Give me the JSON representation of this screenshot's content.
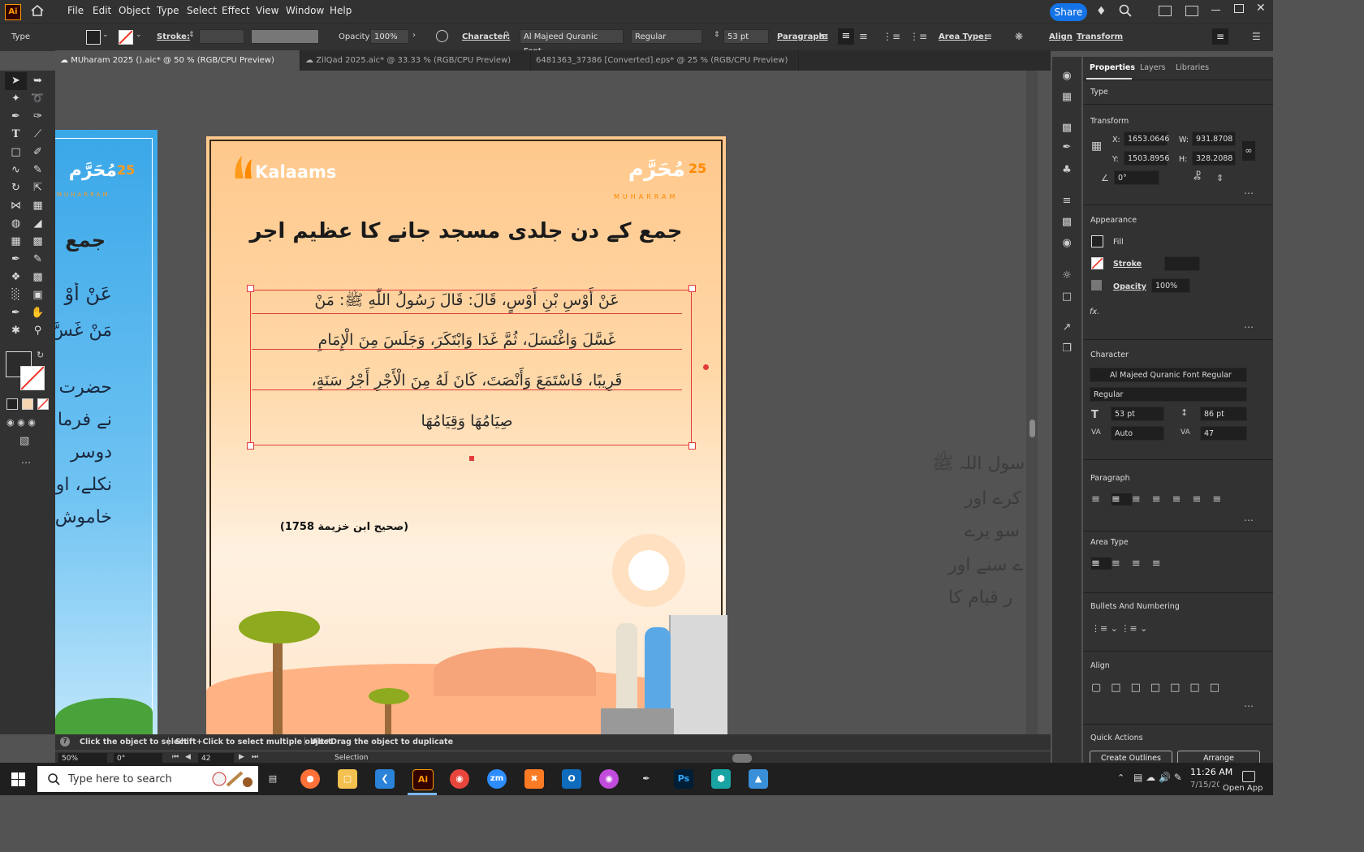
{
  "menu": {
    "logo": "Ai",
    "items": [
      "File",
      "Edit",
      "Object",
      "Type",
      "Select",
      "Effect",
      "View",
      "Window",
      "Help"
    ],
    "share": "Share"
  },
  "control": {
    "tool_label": "Type",
    "stroke_label": "Stroke:",
    "opacity_label": "Opacity:",
    "opacity_value": "100%",
    "character_label": "Character:",
    "font_name": "Al Majeed Quranic Font...",
    "font_style": "Regular",
    "font_size": "53 pt",
    "paragraph_label": "Paragraph:",
    "area_type_label": "Area Type:",
    "align_label": "Align",
    "transform_label": "Transform"
  },
  "tabs": [
    {
      "label": "MUharam 2025 ().aic* @ 50 % (RGB/CPU Preview)"
    },
    {
      "label": "ZilQad 2025.aic* @ 33.33 % (RGB/CPU Preview)"
    },
    {
      "label": "6481363_37386 [Converted].eps* @ 25 % (RGB/CPU Preview)"
    }
  ],
  "artboard": {
    "brand": "Kalaams",
    "logo_number": "25",
    "logo_script": "مُحَرَّم",
    "logo_latin": "MUHARRAM",
    "headline": "جمع کے دن جلدی مسجد جانے کا عظیم اجر",
    "arabic_lines": [
      "عَنْ أَوْسِ بْنِ أَوْسٍ، قَالَ: قَالَ رَسُولُ اللّٰهِ ﷺ: مَنْ",
      "غَسَّلَ وَاغْتَسَلَ، ثُمَّ غَدَا وَابْتَكَرَ، وَجَلَسَ مِنَ الْإِمَامِ",
      "قَرِيبًا، فَاسْتَمَعَ وَأَنْصَتَ، كَانَ لَهُ مِنَ الْأَجْرِ أَجْرُ سَنَةٍ،",
      "صِيَامُهَا وَقِيَامُهَا"
    ],
    "reference": "(صحیح ابن خزیمة 1758)"
  },
  "left_artboard": {
    "title": "جمع",
    "lines": [
      "عَنْ أَوْ",
      "مَنْ غَسَّ",
      "حضرت",
      "نے فرما",
      "دوسر",
      "نکلے، او",
      "خاموش"
    ]
  },
  "right_overflow": {
    "lines": [
      "سول اللہ ﷺ",
      "کرے اور",
      "سو یرے",
      "ے سنے اور",
      "ر قیام کا"
    ]
  },
  "panel": {
    "tabs": [
      "Properties",
      "Layers",
      "Libraries"
    ],
    "type_heading": "Type",
    "transform_heading": "Transform",
    "x_label": "X:",
    "x_value": "1653.0646",
    "y_label": "Y:",
    "y_value": "1503.8956",
    "w_label": "W:",
    "w_value": "931.8708 p",
    "h_label": "H:",
    "h_value": "328.2088 p",
    "rotate_value": "0°",
    "appearance_heading": "Appearance",
    "fill_label": "Fill",
    "stroke_label": "Stroke",
    "opacity_label": "Opacity",
    "opacity_value": "100%",
    "fx_label": "fx.",
    "character_heading": "Character",
    "font_name": "Al Majeed Quranic Font Regular",
    "font_style": "Regular",
    "font_size": "53 pt",
    "leading": "86 pt",
    "kerning": "Auto",
    "tracking": "47",
    "paragraph_heading": "Paragraph",
    "area_type_heading": "Area Type",
    "bullets_heading": "Bullets And Numbering",
    "align_heading": "Align",
    "quick_actions_heading": "Quick Actions",
    "create_outlines": "Create Outlines",
    "arrange": "Arrange"
  },
  "status": {
    "hint1": "Click the object to select",
    "hint2": "Shift+Click to select multiple object",
    "hint3": "Alt+Drag the object to duplicate",
    "zoom": "50%",
    "angle": "0°",
    "artboard_num": "42",
    "mode": "Selection"
  },
  "taskbar": {
    "search_placeholder": "Type here to search",
    "time": "11:26 AM",
    "date": "7/15/2025",
    "open_app": "Open App"
  },
  "colors": {
    "brand_orange": "#ff8a00",
    "share_blue": "#1473e6",
    "selection_red": "#e23a3a"
  }
}
